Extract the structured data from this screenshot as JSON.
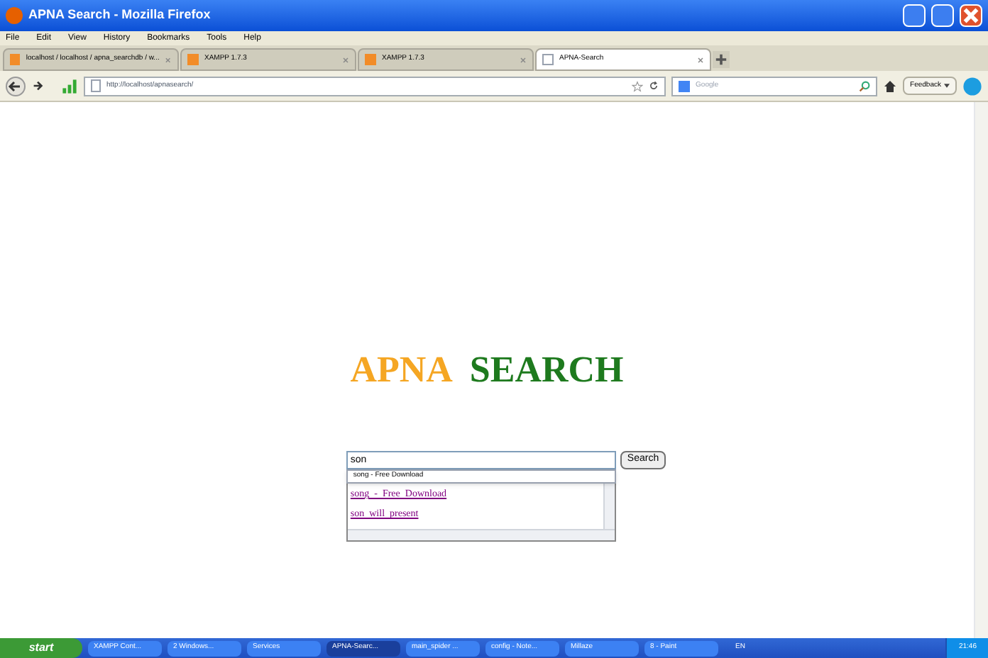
{
  "window": {
    "title": "APNA Search - Mozilla Firefox"
  },
  "menu": [
    "File",
    "Edit",
    "View",
    "History",
    "Bookmarks",
    "Tools",
    "Help"
  ],
  "tabs": [
    {
      "label": "localhost / localhost / apna_searchdb / w...",
      "selected": false
    },
    {
      "label": "XAMPP 1.7.3",
      "selected": false
    },
    {
      "label": "XAMPP 1.7.3",
      "selected": false
    },
    {
      "label": "APNA-Search",
      "selected": true
    }
  ],
  "address": {
    "value": "http://localhost/apnasearch/"
  },
  "web_search": {
    "placeholder": "Google"
  },
  "feedback": "Feedback",
  "page": {
    "logo": [
      "APNA",
      "SEARCH"
    ],
    "query": "son",
    "search_button": "Search",
    "suggestion": "song - Free Download",
    "results": [
      "song  -  Free  Download",
      "son  will  present"
    ]
  },
  "taskbar": {
    "start": "start",
    "items": [
      {
        "label": "XAMPP Cont...",
        "selected": false
      },
      {
        "label": "2 Windows...",
        "selected": false
      },
      {
        "label": "Services",
        "selected": false
      },
      {
        "label": "APNA-Searc...",
        "selected": true
      },
      {
        "label": "main_spider ...",
        "selected": false
      },
      {
        "label": "config - Note...",
        "selected": false
      },
      {
        "label": "Millaze",
        "selected": false
      },
      {
        "label": "8 - Paint",
        "selected": false
      }
    ],
    "language": "EN",
    "clock": "21:46"
  }
}
